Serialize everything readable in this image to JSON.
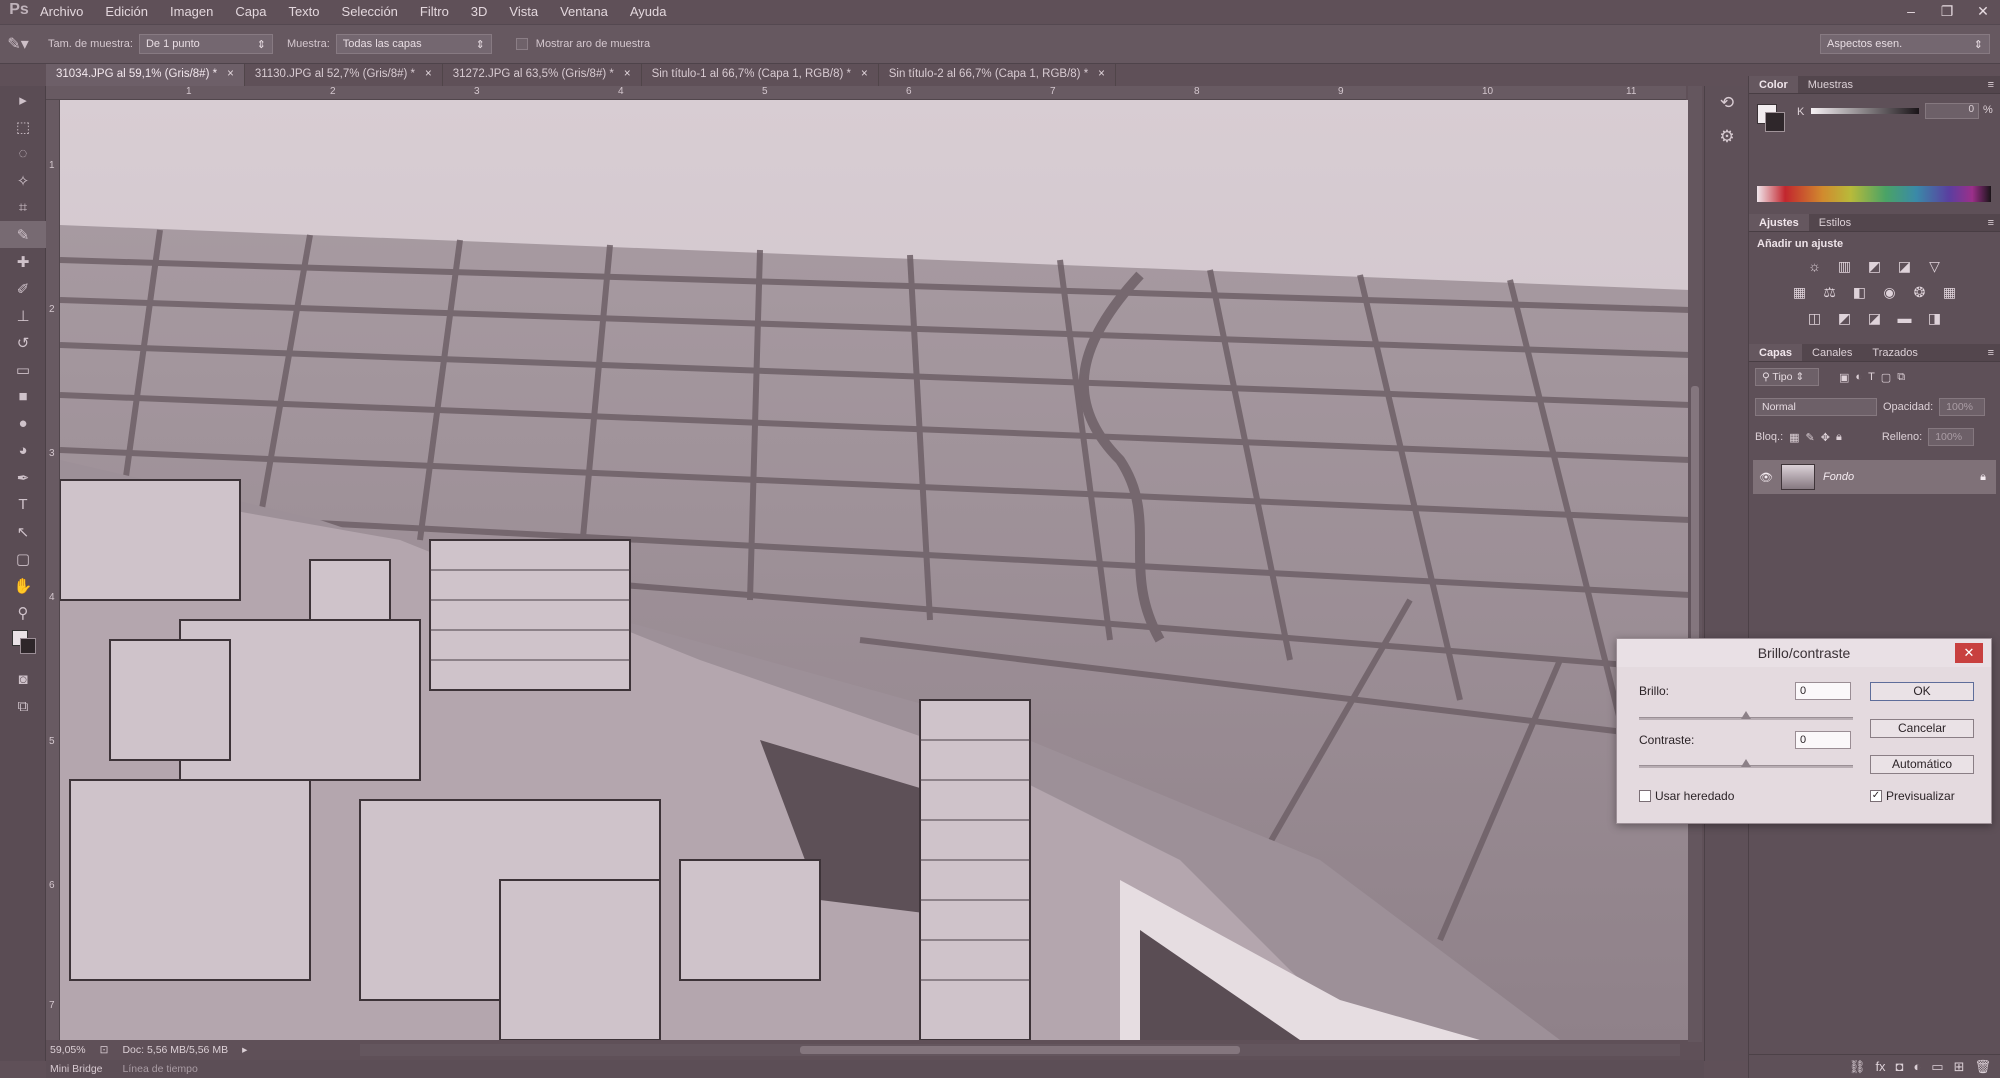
{
  "app": {
    "logo": "Ps"
  },
  "menu": [
    "Archivo",
    "Edición",
    "Imagen",
    "Capa",
    "Texto",
    "Selección",
    "Filtro",
    "3D",
    "Vista",
    "Ventana",
    "Ayuda"
  ],
  "window_controls": {
    "minimize": "–",
    "restore": "❐",
    "close": "✕"
  },
  "options": {
    "sample_size_label": "Tam. de muestra:",
    "sample_size_value": "De 1 punto",
    "sample_label": "Muestra:",
    "sample_value": "Todas las capas",
    "show_ring_label": "Mostrar aro de muestra",
    "workspace": "Aspectos esen."
  },
  "tabs": [
    {
      "label": "31034.JPG al 59,1% (Gris/8#) *",
      "active": true
    },
    {
      "label": "31130.JPG al 52,7% (Gris/8#) *",
      "active": false
    },
    {
      "label": "31272.JPG al 63,5% (Gris/8#) *",
      "active": false
    },
    {
      "label": "Sin título-1 al 66,7% (Capa 1, RGB/8) *",
      "active": false
    },
    {
      "label": "Sin título-2 al 66,7% (Capa 1, RGB/8) *",
      "active": false
    }
  ],
  "ruler_top": [
    "1",
    "2",
    "3",
    "4",
    "5",
    "6",
    "7",
    "8",
    "9",
    "10",
    "11"
  ],
  "ruler_left": [
    "1",
    "2",
    "3",
    "4",
    "5",
    "6",
    "7"
  ],
  "status": {
    "zoom": "59,05%",
    "doc": "Doc: 5,56 MB/5,56 MB"
  },
  "bottom_tabs": {
    "bridge": "Mini Bridge",
    "timeline": "Línea de tiempo"
  },
  "panels": {
    "color_tabs": [
      "Color",
      "Muestras"
    ],
    "color_k_label": "K",
    "color_k_value": "0",
    "color_k_unit": "%",
    "adjust_tabs": [
      "Ajustes",
      "Estilos"
    ],
    "adjust_title": "Añadir un ajuste",
    "layers_tabs": [
      "Capas",
      "Canales",
      "Trazados"
    ],
    "filter_kind": "Tipo",
    "blend_mode": "Normal",
    "opacity_label": "Opacidad:",
    "opacity_value": "100%",
    "lock_label": "Bloq.:",
    "fill_label": "Relleno:",
    "fill_value": "100%",
    "layer_name": "Fondo"
  },
  "dialog": {
    "title": "Brillo/contraste",
    "brightness_label": "Brillo:",
    "brightness_value": "0",
    "contrast_label": "Contraste:",
    "contrast_value": "0",
    "ok": "OK",
    "cancel": "Cancelar",
    "auto": "Automático",
    "legacy": "Usar heredado",
    "legacy_checked": false,
    "preview": "Previsualizar",
    "preview_checked": true
  }
}
